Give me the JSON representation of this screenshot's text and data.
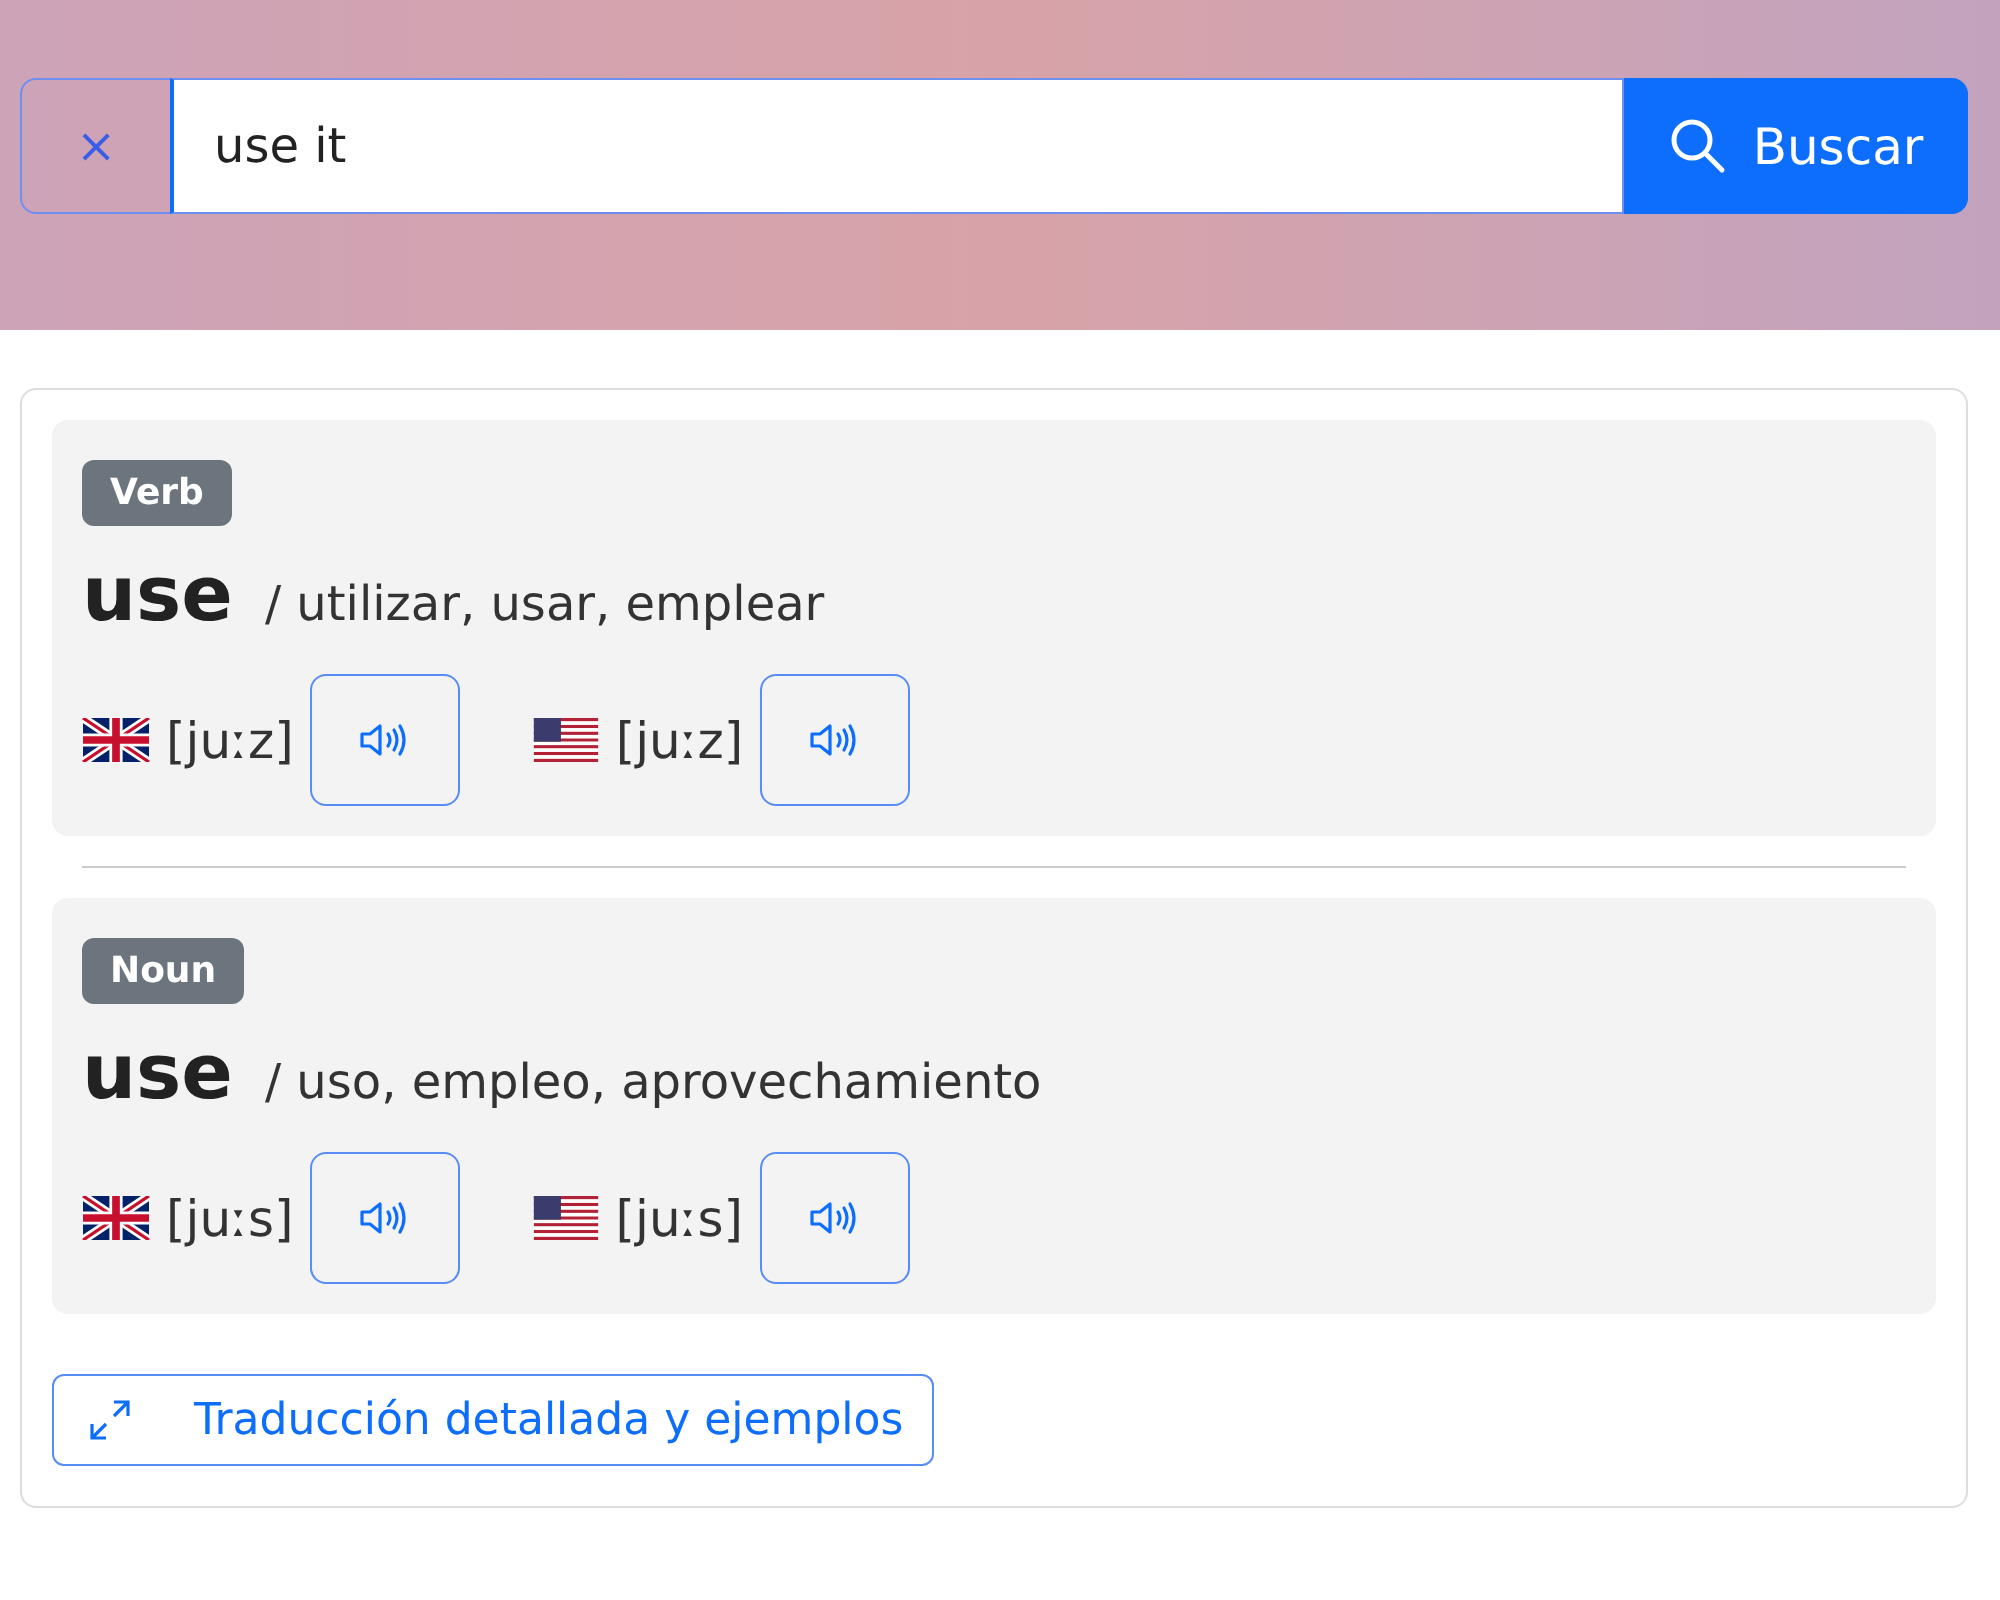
{
  "search": {
    "clear": "×",
    "value": "use it",
    "button": "Buscar"
  },
  "entries": [
    {
      "pos": "Verb",
      "word": "use",
      "translation": "/ utilizar, usar, emplear",
      "pronunciations": [
        {
          "kind": "uk",
          "ipa": "[juːz]"
        },
        {
          "kind": "us",
          "ipa": "[juːz]"
        }
      ]
    },
    {
      "pos": "Noun",
      "word": "use",
      "translation": "/ uso, empleo, aprovechamiento",
      "pronunciations": [
        {
          "kind": "uk",
          "ipa": "[juːs]"
        },
        {
          "kind": "us",
          "ipa": "[juːs]"
        }
      ]
    }
  ],
  "details_button": "Traducción detallada y ejemplos"
}
